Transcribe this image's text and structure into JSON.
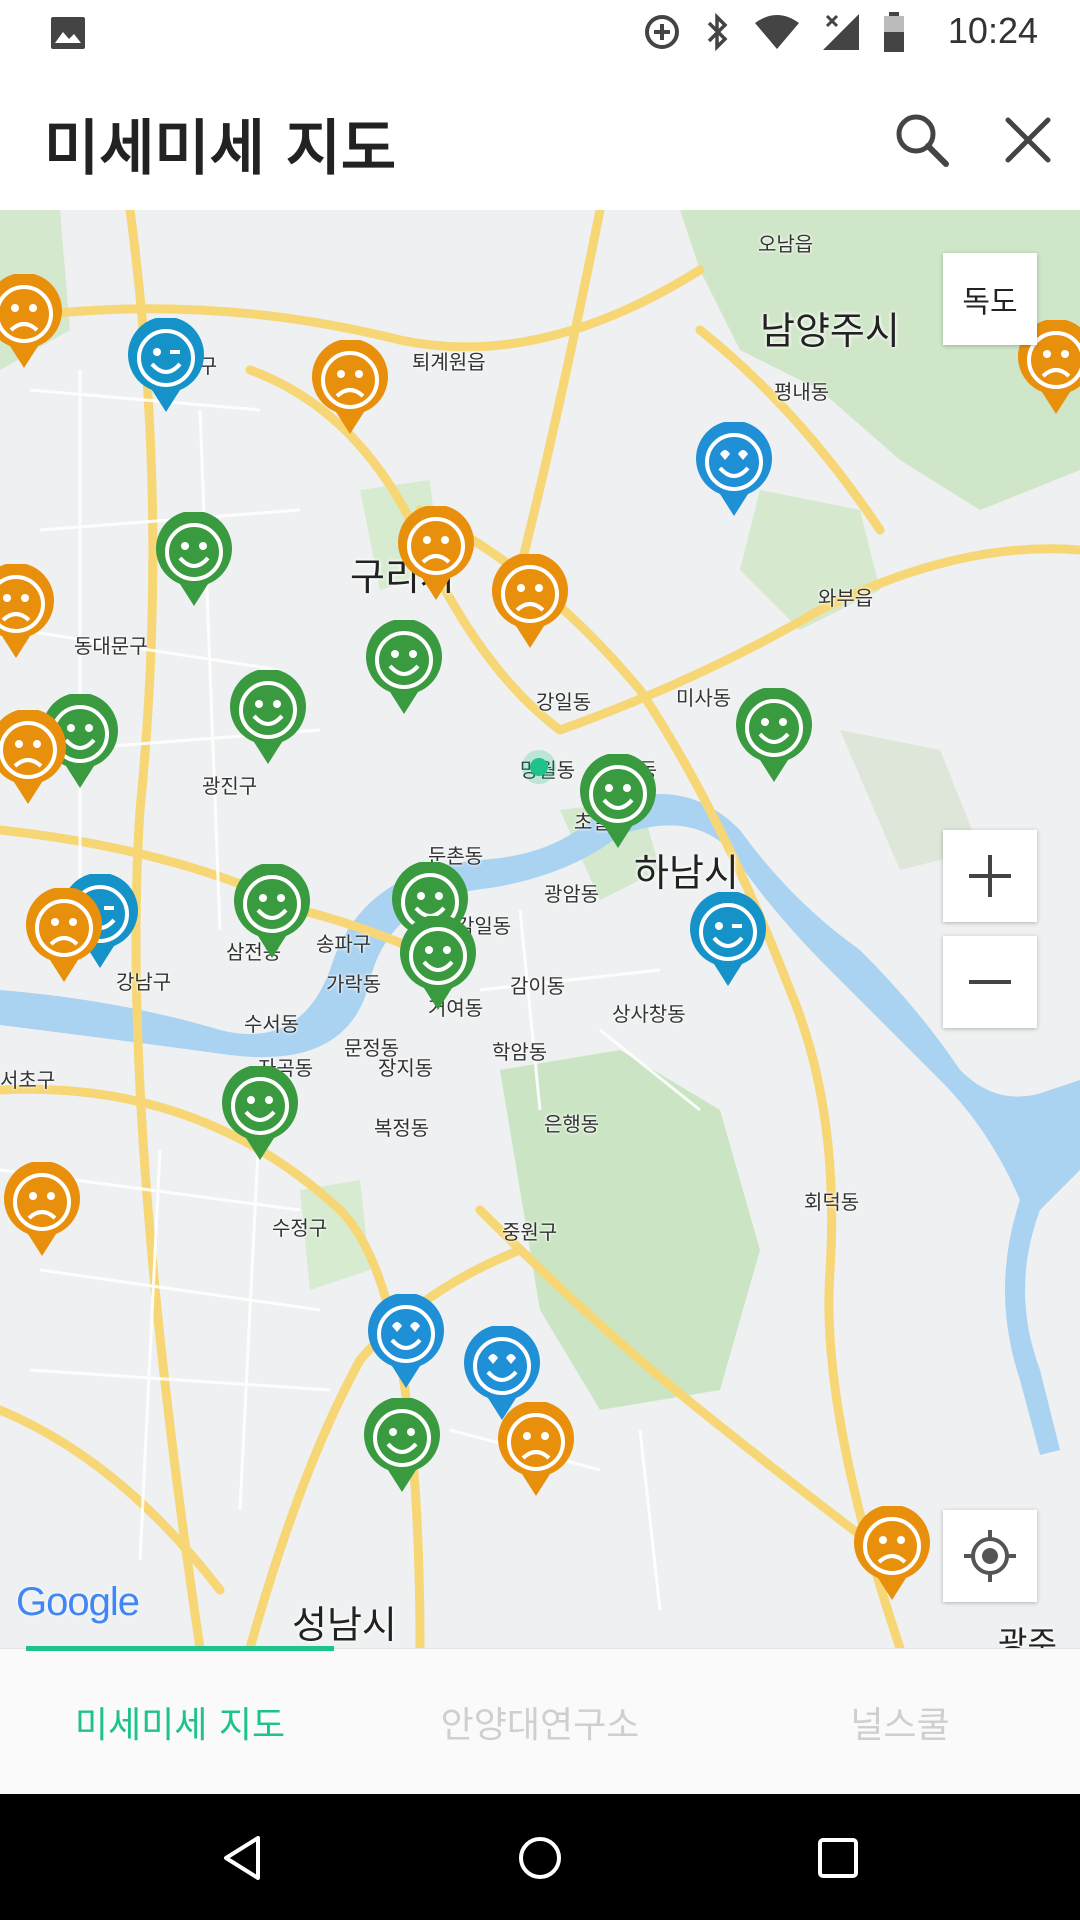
{
  "status_bar": {
    "time": "10:24",
    "icons": [
      "image-icon",
      "data-saver-icon",
      "bluetooth-icon",
      "wifi-icon",
      "signal-icon",
      "battery-icon"
    ]
  },
  "app_bar": {
    "title": "미세미세 지도",
    "actions": [
      "search-icon",
      "close-icon"
    ]
  },
  "map": {
    "dokdo_button": "독도",
    "attribution": "Google",
    "places": [
      "노원구",
      "퇴계원읍",
      "오남읍",
      "평내동",
      "동대문구",
      "와부읍",
      "강일동",
      "미사동",
      "광진구",
      "풍산동",
      "망월동",
      "초일동",
      "둔촌동",
      "광암동",
      "삼전동",
      "송파구",
      "감일동",
      "강남구",
      "가락동",
      "감이동",
      "상사창동",
      "수서동",
      "문정동",
      "거여동",
      "자곡동",
      "장지동",
      "학암동",
      "서초구",
      "복정동",
      "은행동",
      "수정구",
      "중원구",
      "회덕동"
    ],
    "cities": [
      "남양주시",
      "구리시",
      "하남시",
      "성남시",
      "광주"
    ],
    "markers": [
      {
        "status": "bad",
        "color": "#e8900c"
      },
      {
        "status": "good",
        "color": "#3a9a3f"
      },
      {
        "status": "very-good",
        "color": "#1593c9"
      },
      {
        "status": "best",
        "color": "#1f8fd6"
      }
    ]
  },
  "tabs": [
    {
      "label": "미세미세 지도",
      "active": true
    },
    {
      "label": "안양대연구소",
      "active": false
    },
    {
      "label": "널스쿨",
      "active": false
    }
  ],
  "colors": {
    "accent": "#1ec28b",
    "tab_inactive": "#cfcfcf"
  },
  "nav_bar": {
    "buttons": [
      "back-icon",
      "home-icon",
      "recents-icon"
    ]
  }
}
